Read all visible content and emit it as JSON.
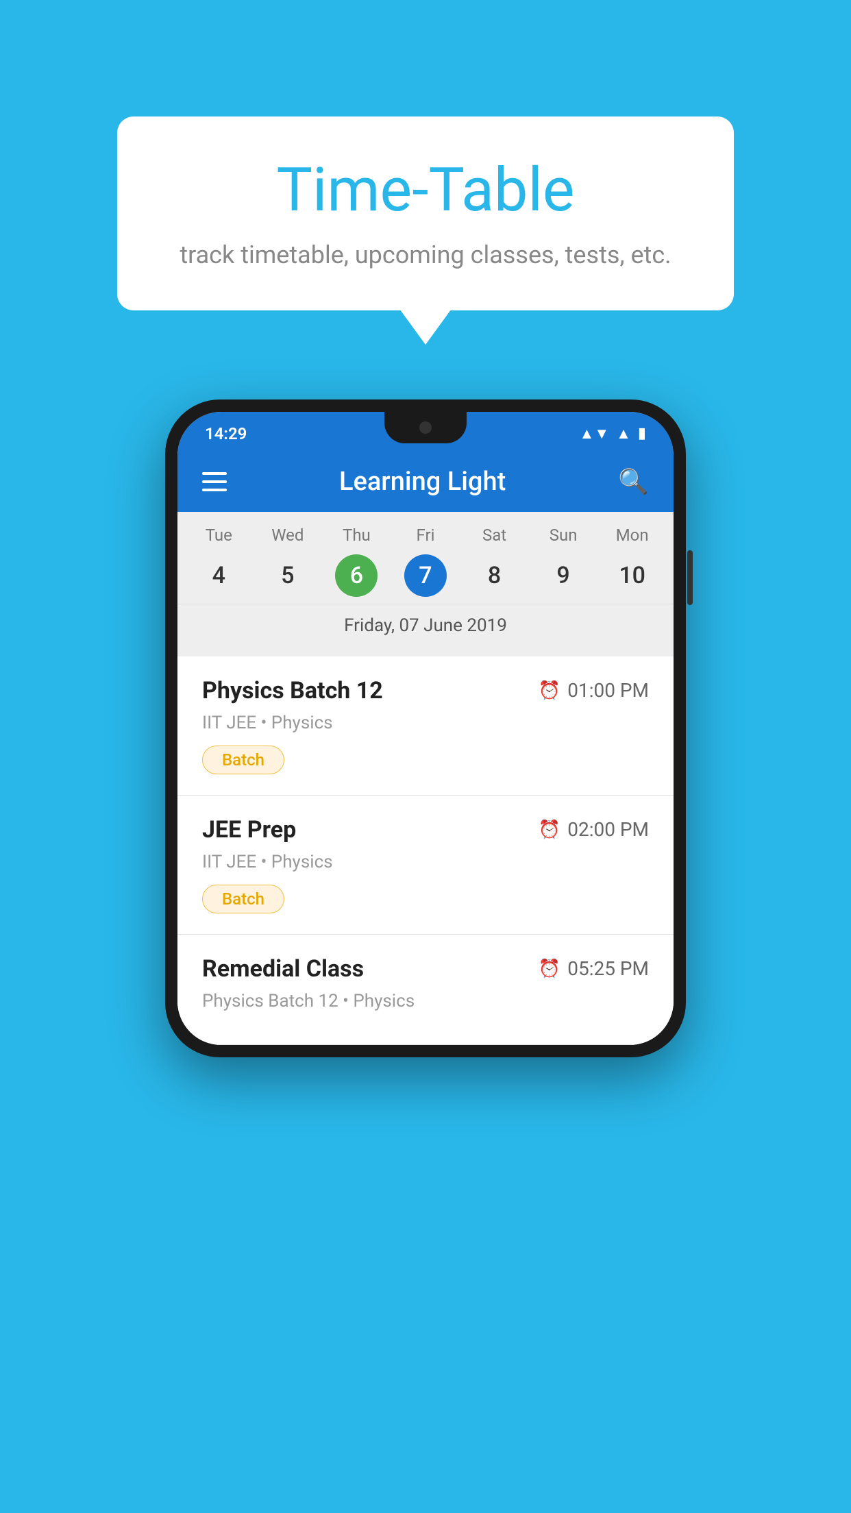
{
  "background_color": "#29B6E8",
  "bubble": {
    "title": "Time-Table",
    "subtitle": "track timetable, upcoming classes, tests, etc."
  },
  "phone": {
    "status_bar": {
      "time": "14:29"
    },
    "app_bar": {
      "title": "Learning Light",
      "menu_icon_label": "hamburger-menu",
      "search_icon_label": "search"
    },
    "calendar": {
      "days": [
        {
          "label": "Tue",
          "num": "4",
          "state": "normal"
        },
        {
          "label": "Wed",
          "num": "5",
          "state": "normal"
        },
        {
          "label": "Thu",
          "num": "6",
          "state": "today"
        },
        {
          "label": "Fri",
          "num": "7",
          "state": "selected"
        },
        {
          "label": "Sat",
          "num": "8",
          "state": "normal"
        },
        {
          "label": "Sun",
          "num": "9",
          "state": "normal"
        },
        {
          "label": "Mon",
          "num": "10",
          "state": "normal"
        }
      ],
      "selected_date": "Friday, 07 June 2019"
    },
    "schedule": [
      {
        "title": "Physics Batch 12",
        "time": "01:00 PM",
        "subtitle": "IIT JEE • Physics",
        "badge": "Batch"
      },
      {
        "title": "JEE Prep",
        "time": "02:00 PM",
        "subtitle": "IIT JEE • Physics",
        "badge": "Batch"
      },
      {
        "title": "Remedial Class",
        "time": "05:25 PM",
        "subtitle": "Physics Batch 12 • Physics",
        "badge": null
      }
    ]
  }
}
